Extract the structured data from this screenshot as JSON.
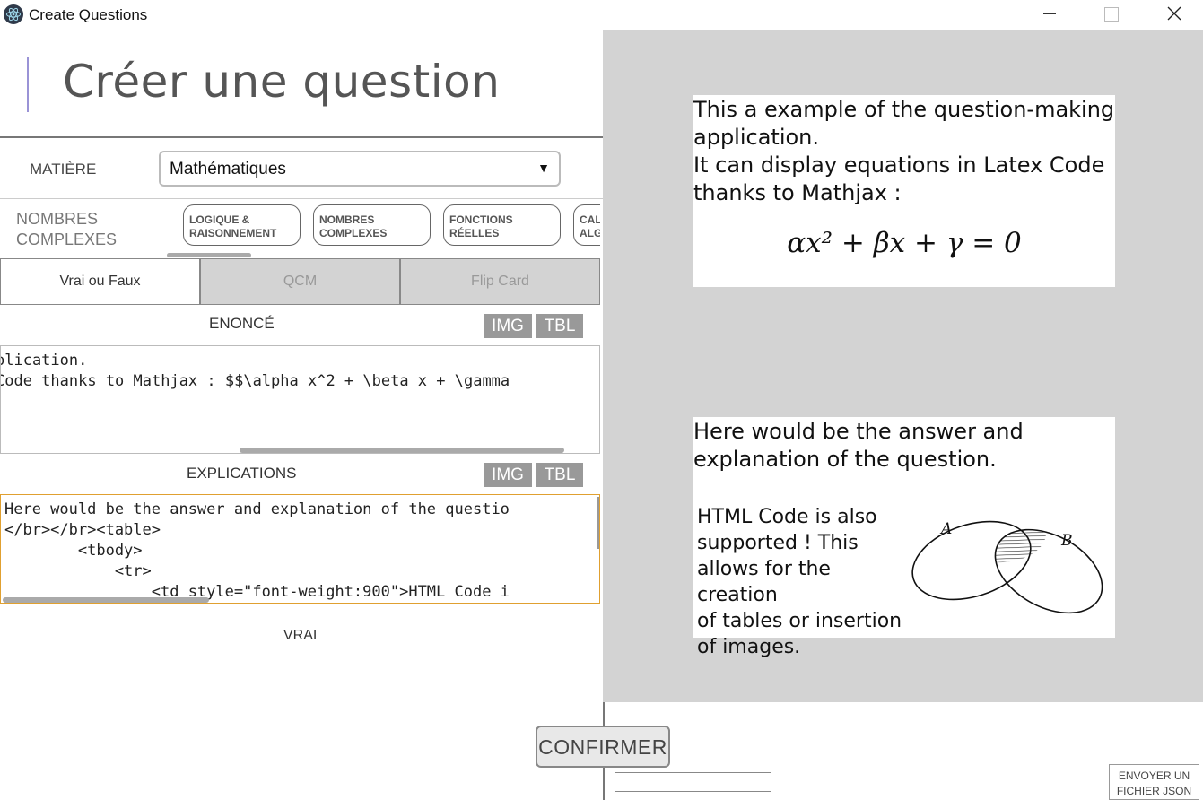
{
  "window": {
    "title": "Create Questions",
    "icon": "electron-atom-icon"
  },
  "page": {
    "title": "Créer une question"
  },
  "subject": {
    "label": "MATIÈRE",
    "selected": "Mathématiques"
  },
  "category": {
    "current": "NOMBRES COMPLEXES",
    "chips": [
      "LOGIQUE & RAISONNEMENT",
      "NOMBRES COMPLEXES",
      "FONCTIONS RÉELLES",
      "CAL ALG"
    ]
  },
  "question_types": [
    {
      "label": "Vrai ou Faux",
      "active": true
    },
    {
      "label": "QCM",
      "active": false
    },
    {
      "label": "Flip Card",
      "active": false
    }
  ],
  "statement": {
    "label": "ENONCÉ",
    "img_label": "IMG",
    "tbl_label": "TBL",
    "lines": [
      "plication.",
      "Code thanks to Mathjax : $$\\alpha x^2 + \\beta x + \\gamma"
    ]
  },
  "explanation": {
    "label": "EXPLICATIONS",
    "img_label": "IMG",
    "tbl_label": "TBL",
    "lines": [
      "Here would be the answer and explanation of the questio",
      "</br></br><table>",
      "        <tbody>",
      "            <tr>",
      "                <td style=\"font-weight:900\">HTML Code i"
    ]
  },
  "answer": {
    "value": "VRAI"
  },
  "preview": {
    "question_lines": [
      "This a example of the question-making",
      "application.",
      "It can display equations in Latex Code",
      "thanks to Mathjax :"
    ],
    "equation": "αx² + βx + γ = 0",
    "answer_lines": [
      "Here would be the answer and",
      "explanation of the question."
    ],
    "html_lines": [
      "HTML Code is also",
      "supported ! This",
      "allows for the creation",
      "of tables or insertion",
      "of images."
    ],
    "venn_labels": {
      "a": "A",
      "b": "B"
    }
  },
  "actions": {
    "confirm": "CONFIRMER",
    "send_json": "ENVOYER UN FICHIER JSON"
  }
}
